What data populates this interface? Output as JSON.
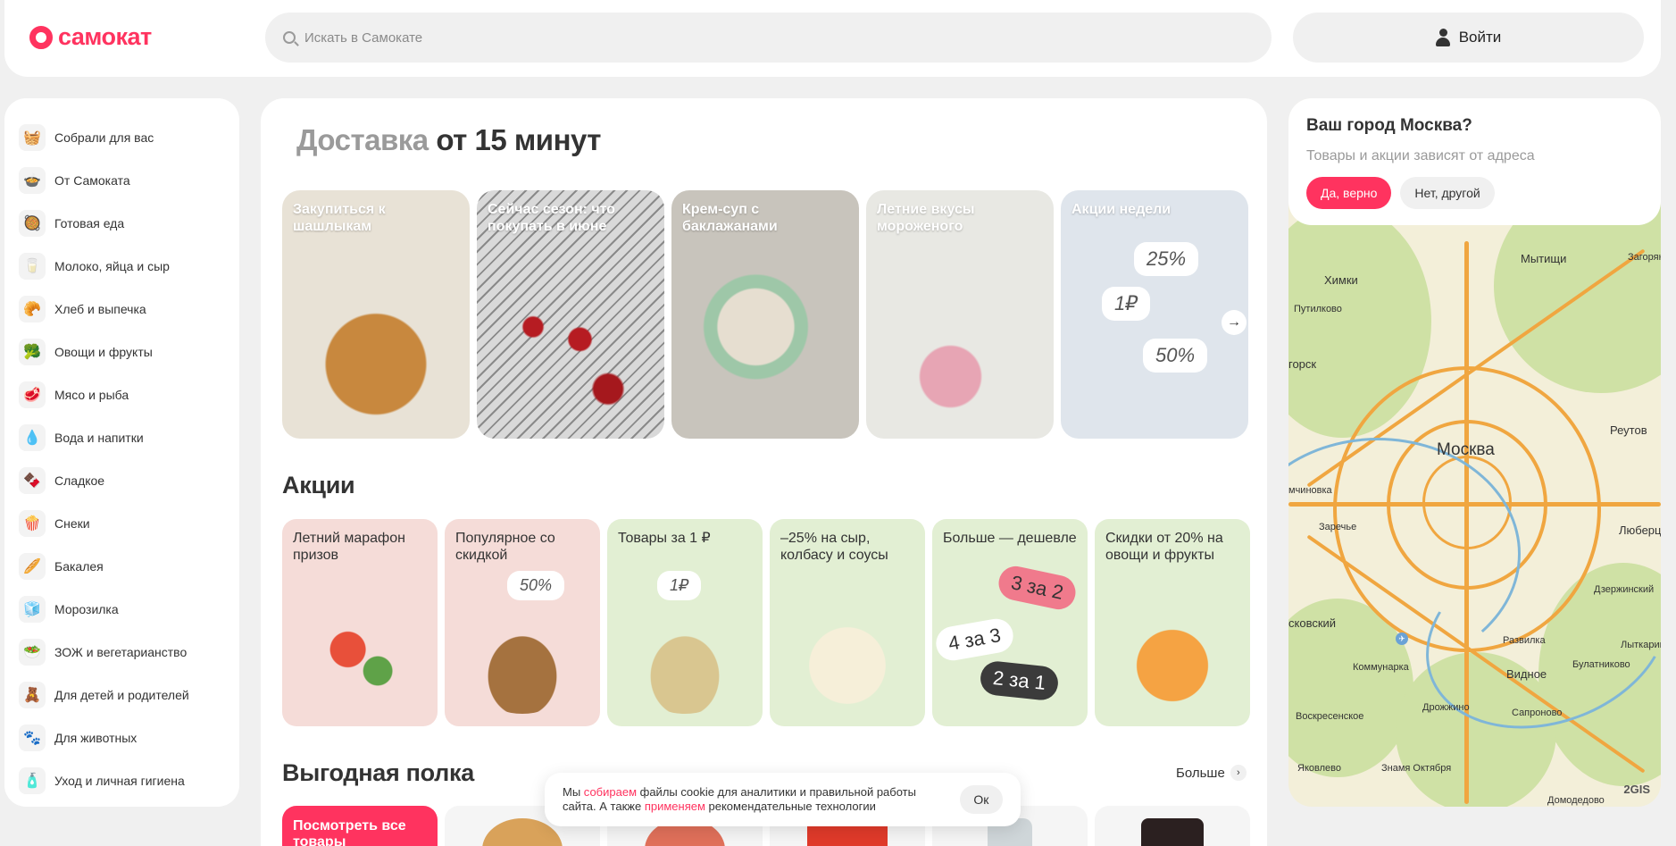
{
  "header": {
    "logo_text": "самокат",
    "search_placeholder": "Искать в Самокате",
    "login_label": "Войти"
  },
  "sidebar": {
    "items": [
      {
        "label": "Собрали для вас",
        "icon": "basket-icon",
        "glyph": "🧺"
      },
      {
        "label": "От Самоката",
        "icon": "meal-icon",
        "glyph": "🍲"
      },
      {
        "label": "Готовая еда",
        "icon": "ready-food-icon",
        "glyph": "🥘"
      },
      {
        "label": "Молоко, яйца и сыр",
        "icon": "milk-icon",
        "glyph": "🥛"
      },
      {
        "label": "Хлеб и выпечка",
        "icon": "bread-icon",
        "glyph": "🥐"
      },
      {
        "label": "Овощи и фрукты",
        "icon": "vegetables-icon",
        "glyph": "🥦"
      },
      {
        "label": "Мясо и рыба",
        "icon": "meat-icon",
        "glyph": "🥩"
      },
      {
        "label": "Вода и напитки",
        "icon": "water-icon",
        "glyph": "💧"
      },
      {
        "label": "Сладкое",
        "icon": "sweets-icon",
        "glyph": "🍫"
      },
      {
        "label": "Снеки",
        "icon": "snacks-icon",
        "glyph": "🍿"
      },
      {
        "label": "Бакалея",
        "icon": "grocery-icon",
        "glyph": "🥖"
      },
      {
        "label": "Морозилка",
        "icon": "freezer-icon",
        "glyph": "🧊"
      },
      {
        "label": "ЗОЖ и вегетарианство",
        "icon": "healthy-icon",
        "glyph": "🥗"
      },
      {
        "label": "Для детей и родителей",
        "icon": "kids-icon",
        "glyph": "🧸"
      },
      {
        "label": "Для животных",
        "icon": "pets-icon",
        "glyph": "🐾"
      },
      {
        "label": "Уход и личная гигиена",
        "icon": "hygiene-icon",
        "glyph": "🧴"
      }
    ]
  },
  "main": {
    "delivery_title_grey": "Доставка",
    "delivery_title_dark": "от 15 минут",
    "stories": [
      {
        "title": "Закупиться к шашлыкам"
      },
      {
        "title": "Сейчас сезон: что покупать в июне"
      },
      {
        "title": "Крем-суп с баклажанами"
      },
      {
        "title": "Летние вкусы мороженого"
      },
      {
        "title": "Акции недели",
        "tags": [
          "25%",
          "1₽",
          "50%"
        ]
      }
    ],
    "promos_title": "Акции",
    "promos": [
      {
        "title": "Летний марафон призов",
        "color": "pink"
      },
      {
        "title": "Популярное со скидкой",
        "color": "pink",
        "tag": "50%"
      },
      {
        "title": "Товары за 1 ₽",
        "color": "green",
        "tag": "1₽"
      },
      {
        "title": "–25% на сыр, колбасу и соусы",
        "color": "green"
      },
      {
        "title": "Больше — дешевле",
        "color": "green",
        "pills": [
          "3 за 2",
          "4 за 3",
          "2 за 1"
        ]
      },
      {
        "title": "Скидки от 20% на овощи и фрукты",
        "color": "green"
      }
    ],
    "shelf_title": "Выгодная полка",
    "shelf_more": "Больше",
    "shelf_cta": "Посмотреть все товары"
  },
  "cookie": {
    "text_1": "Мы ",
    "link_1": "собираем",
    "text_2": " файлы cookie для аналитики и правильной работы сайта. А также ",
    "link_2": "применяем",
    "text_3": " рекомендательные технологии",
    "ok_label": "Ок"
  },
  "city": {
    "question": "Ваш город Москва?",
    "subtitle": "Товары и акции зависят от адреса",
    "yes_label": "Да, верно",
    "no_label": "Нет, другой"
  },
  "map": {
    "labels": [
      "Мытищи",
      "Химки",
      "Путилково",
      "горск",
      "Москва",
      "Реутов",
      "мчиновка",
      "Заречье",
      "Люберцы",
      "Дзержинский",
      "сковский",
      "Развилка",
      "Лыткарино",
      "Коммунарка",
      "Видное",
      "Булатниково",
      "Дрожжино",
      "Сапроново",
      "Воскресенское",
      "Яковлево",
      "Знамя Октября",
      "Домодедово",
      "Загорянский"
    ],
    "brand": "2GIS"
  },
  "colors": {
    "accent": "#ff335f",
    "promo_pink": "#f5dcd8",
    "promo_green": "#e2efd3"
  }
}
